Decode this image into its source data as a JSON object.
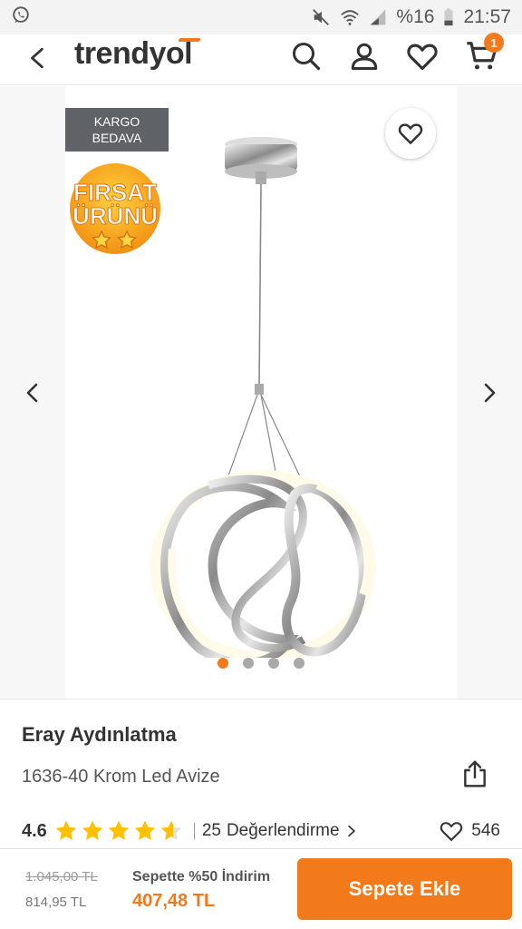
{
  "status_bar": {
    "battery_text": "%16",
    "time": "21:57",
    "icons": [
      "whatsapp-icon",
      "mute-icon",
      "wifi-icon",
      "signal-icon",
      "battery-icon"
    ]
  },
  "header": {
    "logo": "trendyol",
    "cart_count": "1",
    "icons": [
      "back-arrow-icon",
      "search-icon",
      "user-icon",
      "heart-icon",
      "cart-icon"
    ]
  },
  "gallery": {
    "badge_kargo_line1": "KARGO",
    "badge_kargo_line2": "BEDAVA",
    "badge_firsat_line1": "FIRSAT",
    "badge_firsat_line2": "ÜRÜNÜ",
    "dot_count": 4,
    "active_dot": 1
  },
  "product": {
    "brand": "Eray Aydınlatma",
    "name": "1636-40 Krom Led Avize",
    "rating": "4.6",
    "rating_value": 4.6,
    "reviews_count": "25",
    "reviews_label": "Değerlendirme",
    "likes": "546"
  },
  "pricing": {
    "old_price": "1.045,00 TL",
    "price": "814,95 TL",
    "promo_label": "Sepette %50 İndirim",
    "promo_price": "407,48 TL",
    "cta_label": "Sepete Ekle"
  },
  "colors": {
    "accent": "#f27a1a",
    "badge_gray": "#5f6368"
  }
}
